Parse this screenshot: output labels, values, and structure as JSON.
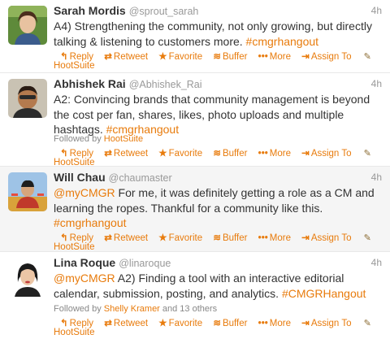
{
  "tweets": [
    {
      "name": "Sarah Mordis",
      "handle": "@sprout_sarah",
      "time": "4h",
      "text_plain": "A4) Strengthening the community, not only growing, but directly talking & listening to customers more. ",
      "hashtag": "#cmgrhangout",
      "actions": {
        "reply": "Reply",
        "retweet": "Retweet",
        "favorite": "Favorite",
        "buffer": "Buffer",
        "more": "More",
        "assign": "Assign To"
      },
      "wrapped_action": "HootSuite"
    },
    {
      "name": "Abhishek Rai",
      "handle": "@Abhishek_Rai",
      "time": "4h",
      "text_plain": "A2: Convincing brands that community management is beyond the cost per fan, shares, likes, photo uploads and multiple hashtags. ",
      "hashtag": "#cmgrhangout",
      "followed_prefix": "Followed by ",
      "followed_by": "HootSuite",
      "actions": {
        "reply": "Reply",
        "retweet": "Retweet",
        "favorite": "Favorite",
        "buffer": "Buffer",
        "more": "More",
        "assign": "Assign To"
      },
      "wrapped_action": "HootSuite"
    },
    {
      "name": "Will Chau",
      "handle": "@chaumaster",
      "time": "4h",
      "mention": "@myCMGR",
      "text_plain": " For me, it was definitely getting a role as a CM and learning the ropes. Thankful for a community like this. ",
      "hashtag": "#cmgrhangout",
      "actions": {
        "reply": "Reply",
        "retweet": "Retweet",
        "favorite": "Favorite",
        "buffer": "Buffer",
        "more": "More",
        "assign": "Assign To"
      },
      "wrapped_action": "HootSuite"
    },
    {
      "name": "Lina Roque",
      "handle": "@linaroque",
      "time": "4h",
      "mention": "@myCMGR",
      "text_plain": " A2) Finding a tool with an interactive editorial calendar, submission, posting, and analytics. ",
      "hashtag": "#CMGRHangout",
      "followed_prefix": "Followed by ",
      "followed_by": "Shelly Kramer",
      "followed_suffix": " and 13 others",
      "actions": {
        "reply": "Reply",
        "retweet": "Retweet",
        "favorite": "Favorite",
        "buffer": "Buffer",
        "more": "More",
        "assign": "Assign To"
      },
      "wrapped_action": "HootSuite"
    }
  ],
  "colors": {
    "accent": "#e87b0c",
    "name": "#333333",
    "meta": "#999999",
    "shaded_row": "#f5f5f5"
  },
  "icons": {
    "reply": "reply-arrow-icon",
    "retweet": "retweet-icon",
    "favorite": "star-icon",
    "buffer": "buffer-stack-icon",
    "more": "more-dots-icon",
    "assign": "assign-to-icon",
    "extension": "extension-icon"
  }
}
